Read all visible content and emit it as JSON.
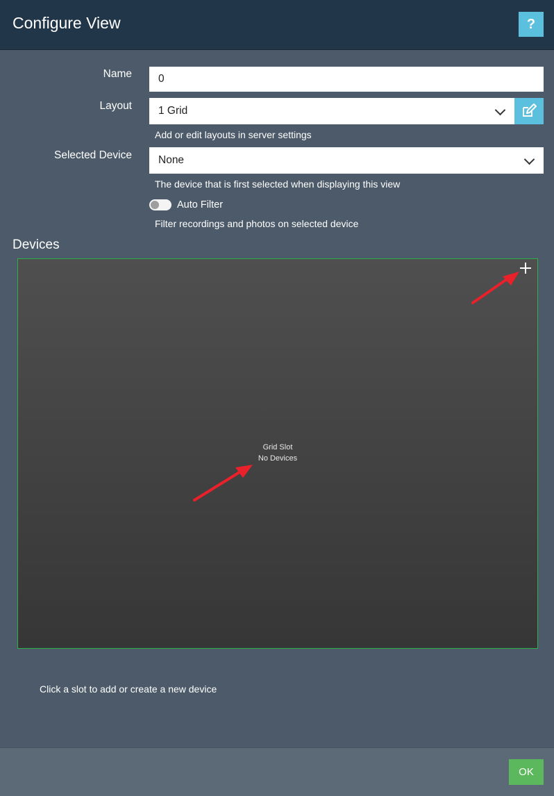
{
  "header": {
    "title": "Configure View",
    "help_label": "?"
  },
  "form": {
    "name": {
      "label": "Name",
      "value": "0"
    },
    "layout": {
      "label": "Layout",
      "value": "1 Grid",
      "help": "Add or edit layouts in server settings"
    },
    "selected_device": {
      "label": "Selected Device",
      "value": "None",
      "help": "The device that is first selected when displaying this view"
    },
    "auto_filter": {
      "label": "Auto Filter",
      "enabled": false,
      "help": "Filter recordings and photos on selected device"
    }
  },
  "devices": {
    "title": "Devices",
    "slot": {
      "line1": "Grid Slot",
      "line2": "No Devices"
    },
    "note": "Click a slot to add or create a new device"
  },
  "footer": {
    "ok_label": "OK"
  },
  "colors": {
    "header_bg": "#22364a",
    "body_bg": "#4c5a69",
    "accent": "#5bc0de",
    "ok_green": "#5cb85c",
    "slot_border": "#2cb14a",
    "annotation_arrow": "#e8212a"
  },
  "icons": [
    "help-icon",
    "chevron-down-icon",
    "edit-icon",
    "plus-icon"
  ]
}
